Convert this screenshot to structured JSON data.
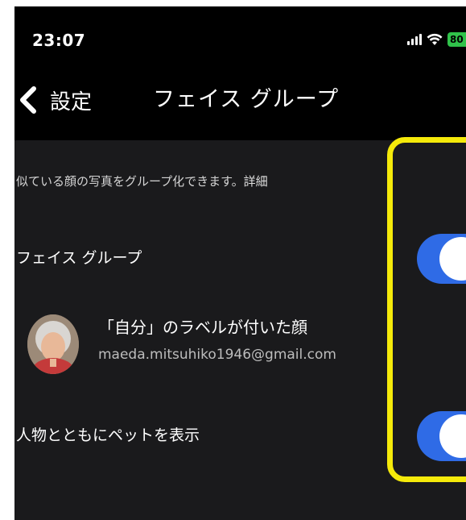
{
  "status_bar": {
    "time": "23:07",
    "battery": "80",
    "signal_icon": "signal-bars-icon",
    "wifi_icon": "wifi-icon",
    "battery_icon": "battery-icon"
  },
  "nav": {
    "back_label": "設定",
    "back_icon": "chevron-left-icon",
    "title": "フェイス グループ"
  },
  "description": {
    "text": "似ている顔の写真をグループ化できます。",
    "link": "詳細"
  },
  "settings": {
    "face_group": {
      "label": "フェイス グループ",
      "toggle_on": true
    },
    "self_label": {
      "title": "「自分」のラベルが付いた顔",
      "email": "maeda.mitsuhiko1946@gmail.com"
    },
    "show_pets": {
      "label": "人物とともにペットを表示",
      "toggle_on": true
    }
  },
  "colors": {
    "toggle_on": "#2f6be6",
    "highlight": "#f5ea0a",
    "background": "#1a1a1c",
    "battery": "#30c24a"
  }
}
